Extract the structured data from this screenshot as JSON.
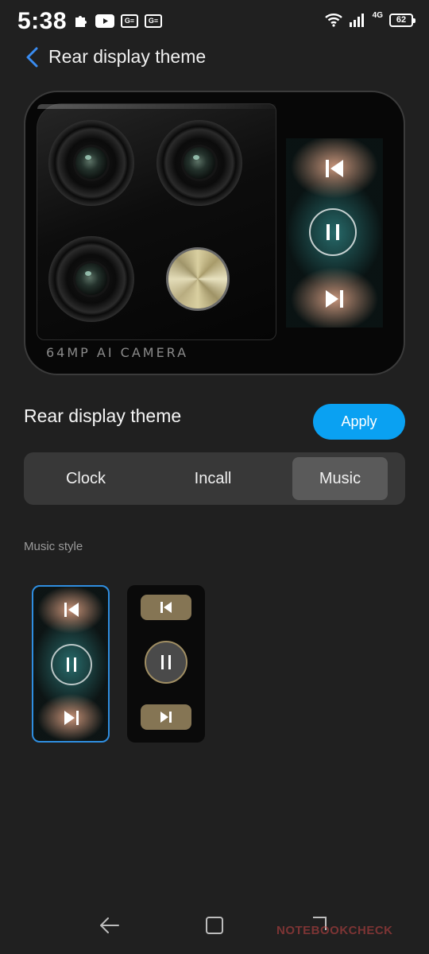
{
  "status_bar": {
    "time": "5:38",
    "left_icons": [
      "puzzle-icon",
      "youtube-icon",
      "news-icon",
      "news-icon"
    ],
    "gbox_label": "G≡",
    "network_label": "4G",
    "battery_level": "62"
  },
  "app_bar": {
    "back_icon": "back-arrow-icon",
    "title": "Rear display theme"
  },
  "preview": {
    "camera_label": "64MP AI CAMERA"
  },
  "theme_section": {
    "title": "Rear display theme",
    "apply_label": "Apply"
  },
  "tabs": [
    {
      "label": "Clock",
      "active": false
    },
    {
      "label": "Incall",
      "active": false
    },
    {
      "label": "Music",
      "active": true
    }
  ],
  "music_style": {
    "label": "Music style",
    "options": [
      {
        "style": "gradient",
        "selected": true
      },
      {
        "style": "gold-pill",
        "selected": false
      }
    ]
  },
  "colors": {
    "accent": "#0aa1f2",
    "selected_border": "#2f8ee0",
    "background": "#202020",
    "segment_bg": "#383838",
    "segment_active": "#5a5a5a",
    "pill_gold": "#857554"
  },
  "nav_bar": {
    "icons": [
      "nav-back-icon",
      "nav-home-icon",
      "nav-recents-icon"
    ]
  },
  "watermark": "NOTEBOOKCHECK"
}
